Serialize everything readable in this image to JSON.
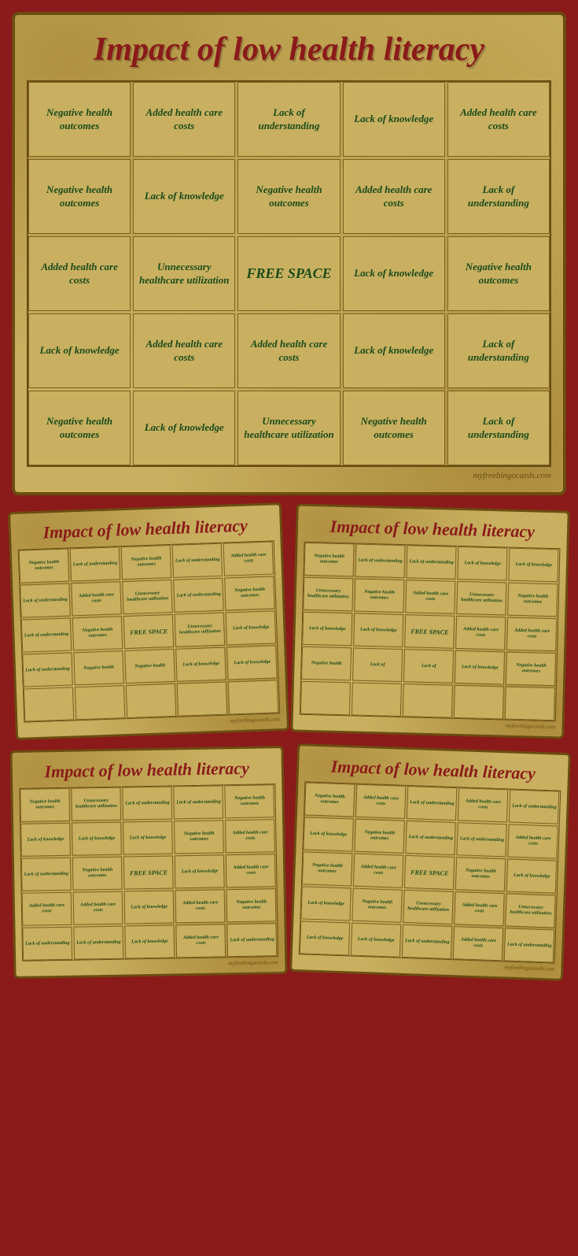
{
  "main_card": {
    "title": "Impact of low health literacy",
    "watermark": "myfreebingocards.com",
    "grid": [
      [
        "Negative health outcomes",
        "Added health care costs",
        "Lack of understanding",
        "Lack of knowledge",
        "Added health care costs"
      ],
      [
        "Negative health outcomes",
        "Lack of knowledge",
        "Negative health outcomes",
        "Added health care costs",
        "Lack of understanding"
      ],
      [
        "Added health care costs",
        "Unnecessary healthcare utilization",
        "FREE SPACE",
        "Lack of knowledge",
        "Negative health outcomes"
      ],
      [
        "Lack of knowledge",
        "Added health care costs",
        "Added health care costs",
        "Lack of knowledge",
        "Lack of understanding"
      ],
      [
        "Negative health outcomes",
        "Lack of knowledge",
        "Unnecessary healthcare utilization",
        "Negative health outcomes",
        "Lack of understanding"
      ]
    ]
  },
  "small_card_1": {
    "title": "Impact of low health literacy",
    "watermark": "myfreebingocards.com",
    "grid": [
      [
        "Negative health outcomes",
        "Lack of understanding",
        "Negative health outcomes",
        "Lack of understanding",
        "Added health care costs"
      ],
      [
        "Lack of understanding",
        "Added health care costs",
        "Unnecessary healthcare utilization",
        "Lack of understanding",
        "Negative health outcomes"
      ],
      [
        "Lack of understanding",
        "Negative health outcomes",
        "FREE SPACE",
        "Unnecessary healthcare utilization",
        "Lack of knowledge"
      ],
      [
        "Lack of understanding",
        "Negative health",
        "Negative health",
        "Lack of knowledge",
        "Lack of knowledge"
      ],
      [
        "",
        "",
        "",
        "",
        ""
      ]
    ]
  },
  "small_card_2": {
    "title": "Impact of low health literacy",
    "watermark": "myfreebingocards.com",
    "grid": [
      [
        "Negative health outcomes",
        "Lack of understanding",
        "Lack of understanding",
        "Lack of knowledge",
        "Lack of knowledge"
      ],
      [
        "Unnecessary healthcare utilization",
        "Negative health outcomes",
        "Added health care costs",
        "Unnecessary healthcare utilization",
        "Negative health outcomes"
      ],
      [
        "Lack of knowledge",
        "Lack of knowledge",
        "FREE SPACE",
        "Added health care costs",
        "Added health care costs"
      ],
      [
        "Negative health",
        "Lack of",
        "Lack of",
        "Lack of knowledge",
        "Negative health outcomes"
      ],
      [
        "",
        "",
        "",
        "",
        ""
      ]
    ]
  },
  "small_card_3": {
    "title": "Impact of low health literacy",
    "watermark": "myfreebingocards.com",
    "grid": [
      [
        "Negative health outcomes",
        "Unnecessary healthcare utilization",
        "Lack of understanding",
        "Lack of understanding",
        "Negative health outcomes"
      ],
      [
        "Lack of knowledge",
        "Lack of knowledge",
        "Lack of knowledge",
        "Negative health outcomes",
        "Added health care costs"
      ],
      [
        "Lack of understanding",
        "Negative health outcomes",
        "FREE SPACE",
        "Lack of knowledge",
        "Added health care costs"
      ],
      [
        "Added health care costs",
        "Added health care costs",
        "Lack of knowledge",
        "Added health care costs",
        "Negative health outcomes"
      ],
      [
        "Lack of understanding",
        "Lack of understanding",
        "Lack of knowledge",
        "Added health care costs",
        "Lack of understanding"
      ]
    ]
  },
  "small_card_4": {
    "title": "Impact of low health literacy",
    "watermark": "myfreebingocards.com",
    "grid": [
      [
        "Negative health outcomes",
        "Added health care costs",
        "Lack of understanding",
        "Added health care costs",
        "Lack of understanding"
      ],
      [
        "Lack of knowledge",
        "Negative health outcomes",
        "Lack of understanding",
        "Lack of understanding",
        "Added health care costs"
      ],
      [
        "Negative health outcomes",
        "Added health care costs",
        "FREE SPACE",
        "Negative health outcomes",
        "Lack of knowledge"
      ],
      [
        "Lack of knowledge",
        "Negative health outcomes",
        "Unnecessary healthcare utilization",
        "Added health care costs",
        "Unnecessary healthcare utilization"
      ],
      [
        "Lack of knowledge",
        "Lack of knowledge",
        "Lack of understanding",
        "Added health care costs",
        "Lack of understanding"
      ]
    ]
  }
}
